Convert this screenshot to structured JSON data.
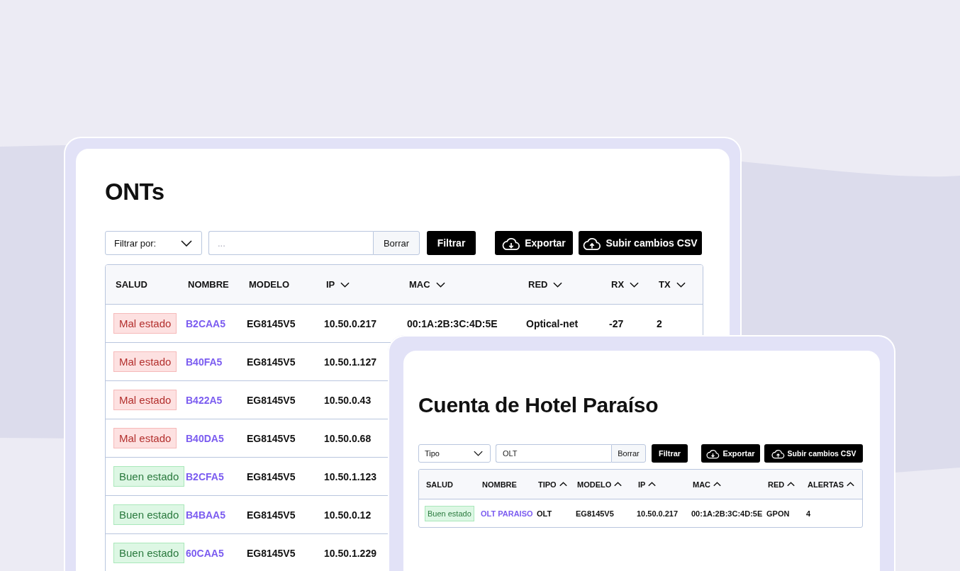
{
  "onts_card": {
    "title": "ONTs",
    "filter": {
      "dropdown": "Filtrar por:",
      "placeholder": "...",
      "clear": "Borrar",
      "apply": "Filtrar"
    },
    "actions": [
      {
        "label": "Exportar",
        "kind": "download"
      },
      {
        "label": "Subir cambios CSV",
        "kind": "upload"
      }
    ],
    "table": {
      "columns": [
        {
          "label": "SALUD",
          "kind": "plain"
        },
        {
          "label": "NOMBRE",
          "kind": "plain"
        },
        {
          "label": "MODELO",
          "kind": "plain"
        },
        {
          "label": "IP",
          "kind": "sort-down"
        },
        {
          "label": "MAC",
          "kind": "sort-down"
        },
        {
          "label": "RED",
          "kind": "sort-down"
        },
        {
          "label": "RX",
          "kind": "sort-down"
        },
        {
          "label": "TX",
          "kind": "sort-down"
        }
      ],
      "rows": [
        {
          "kind": "bad",
          "cells": [
            "Mal estado",
            "B2CAA5",
            "EG8145V5",
            "10.50.0.217",
            "00:1A:2B:3C:4D:5E",
            "Optical-net",
            "-27",
            "2"
          ]
        },
        {
          "kind": "bad",
          "cells": [
            "Mal estado",
            "B40FA5",
            "EG8145V5",
            "10.50.1.127"
          ]
        },
        {
          "kind": "bad",
          "cells": [
            "Mal estado",
            "B422A5",
            "EG8145V5",
            "10.50.0.43"
          ]
        },
        {
          "kind": "bad",
          "cells": [
            "Mal estado",
            "B40DA5",
            "EG8145V5",
            "10.50.0.68"
          ]
        },
        {
          "kind": "good",
          "cells": [
            "Buen estado",
            "B2CFA5",
            "EG8145V5",
            "10.50.1.123"
          ]
        },
        {
          "kind": "good",
          "cells": [
            "Buen estado",
            "B4BAA5",
            "EG8145V5",
            "10.50.0.12"
          ]
        },
        {
          "kind": "good",
          "cells": [
            "Buen estado",
            "60CAA5",
            "EG8145V5",
            "10.50.1.229"
          ]
        }
      ]
    }
  },
  "account_card": {
    "title": "Cuenta de Hotel Paraíso",
    "filter": {
      "dropdown": "Tipo",
      "value": "OLT",
      "clear": "Borrar",
      "apply": "Filtrar"
    },
    "actions": [
      {
        "label": "Exportar",
        "kind": "download"
      },
      {
        "label": "Subir cambios CSV",
        "kind": "upload"
      }
    ],
    "table": {
      "columns": [
        {
          "label": "SALUD",
          "kind": "plain"
        },
        {
          "label": "NOMBRE",
          "kind": "plain"
        },
        {
          "label": "TIPO",
          "kind": "sort-up"
        },
        {
          "label": "MODELO",
          "kind": "sort-up"
        },
        {
          "label": "IP",
          "kind": "sort-up"
        },
        {
          "label": "MAC",
          "kind": "sort-up"
        },
        {
          "label": "RED",
          "kind": "sort-up"
        },
        {
          "label": "ALERTAS",
          "kind": "sort-up"
        }
      ],
      "rows": [
        {
          "kind": "good",
          "cells": [
            "Buen estado",
            "OLT PARAISO",
            "OLT",
            "EG8145V5",
            "10.50.0.217",
            "00:1A:2B:3C:4D:5E",
            "GPON",
            "4"
          ]
        }
      ]
    }
  }
}
